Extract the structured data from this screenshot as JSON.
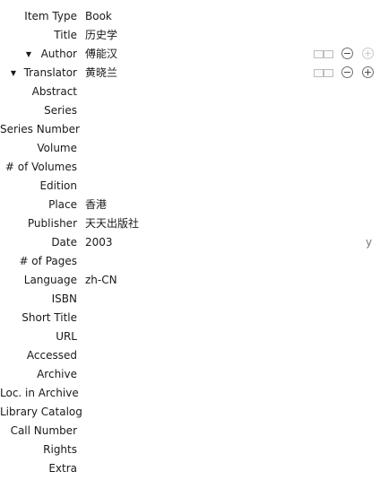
{
  "fields": [
    {
      "label": "Item Type",
      "value": "Book"
    },
    {
      "label": "Title",
      "value": "历史学"
    },
    {
      "label": "Author",
      "value": "傅能汉"
    },
    {
      "label": "Translator",
      "value": "黄晓兰"
    },
    {
      "label": "Abstract",
      "value": ""
    },
    {
      "label": "Series",
      "value": ""
    },
    {
      "label": "Series Number",
      "value": ""
    },
    {
      "label": "Volume",
      "value": ""
    },
    {
      "label": "# of Volumes",
      "value": ""
    },
    {
      "label": "Edition",
      "value": ""
    },
    {
      "label": "Place",
      "value": "香港"
    },
    {
      "label": "Publisher",
      "value": "天天出版社"
    },
    {
      "label": "Date",
      "value": "2003"
    },
    {
      "label": "# of Pages",
      "value": ""
    },
    {
      "label": "Language",
      "value": "zh-CN"
    },
    {
      "label": "ISBN",
      "value": ""
    },
    {
      "label": "Short Title",
      "value": ""
    },
    {
      "label": "URL",
      "value": ""
    },
    {
      "label": "Accessed",
      "value": ""
    },
    {
      "label": "Archive",
      "value": ""
    },
    {
      "label": "Loc. in Archive",
      "value": ""
    },
    {
      "label": "Library Catalog",
      "value": ""
    },
    {
      "label": "Call Number",
      "value": ""
    },
    {
      "label": "Rights",
      "value": ""
    },
    {
      "label": "Extra",
      "value": ""
    }
  ],
  "creator_controls": {
    "twisty_glyph": "▼",
    "minus_glyph": "−",
    "plus_glyph": "+",
    "switch_icon": "creator-name-mode-switch-icon"
  },
  "date_indicator": "y"
}
